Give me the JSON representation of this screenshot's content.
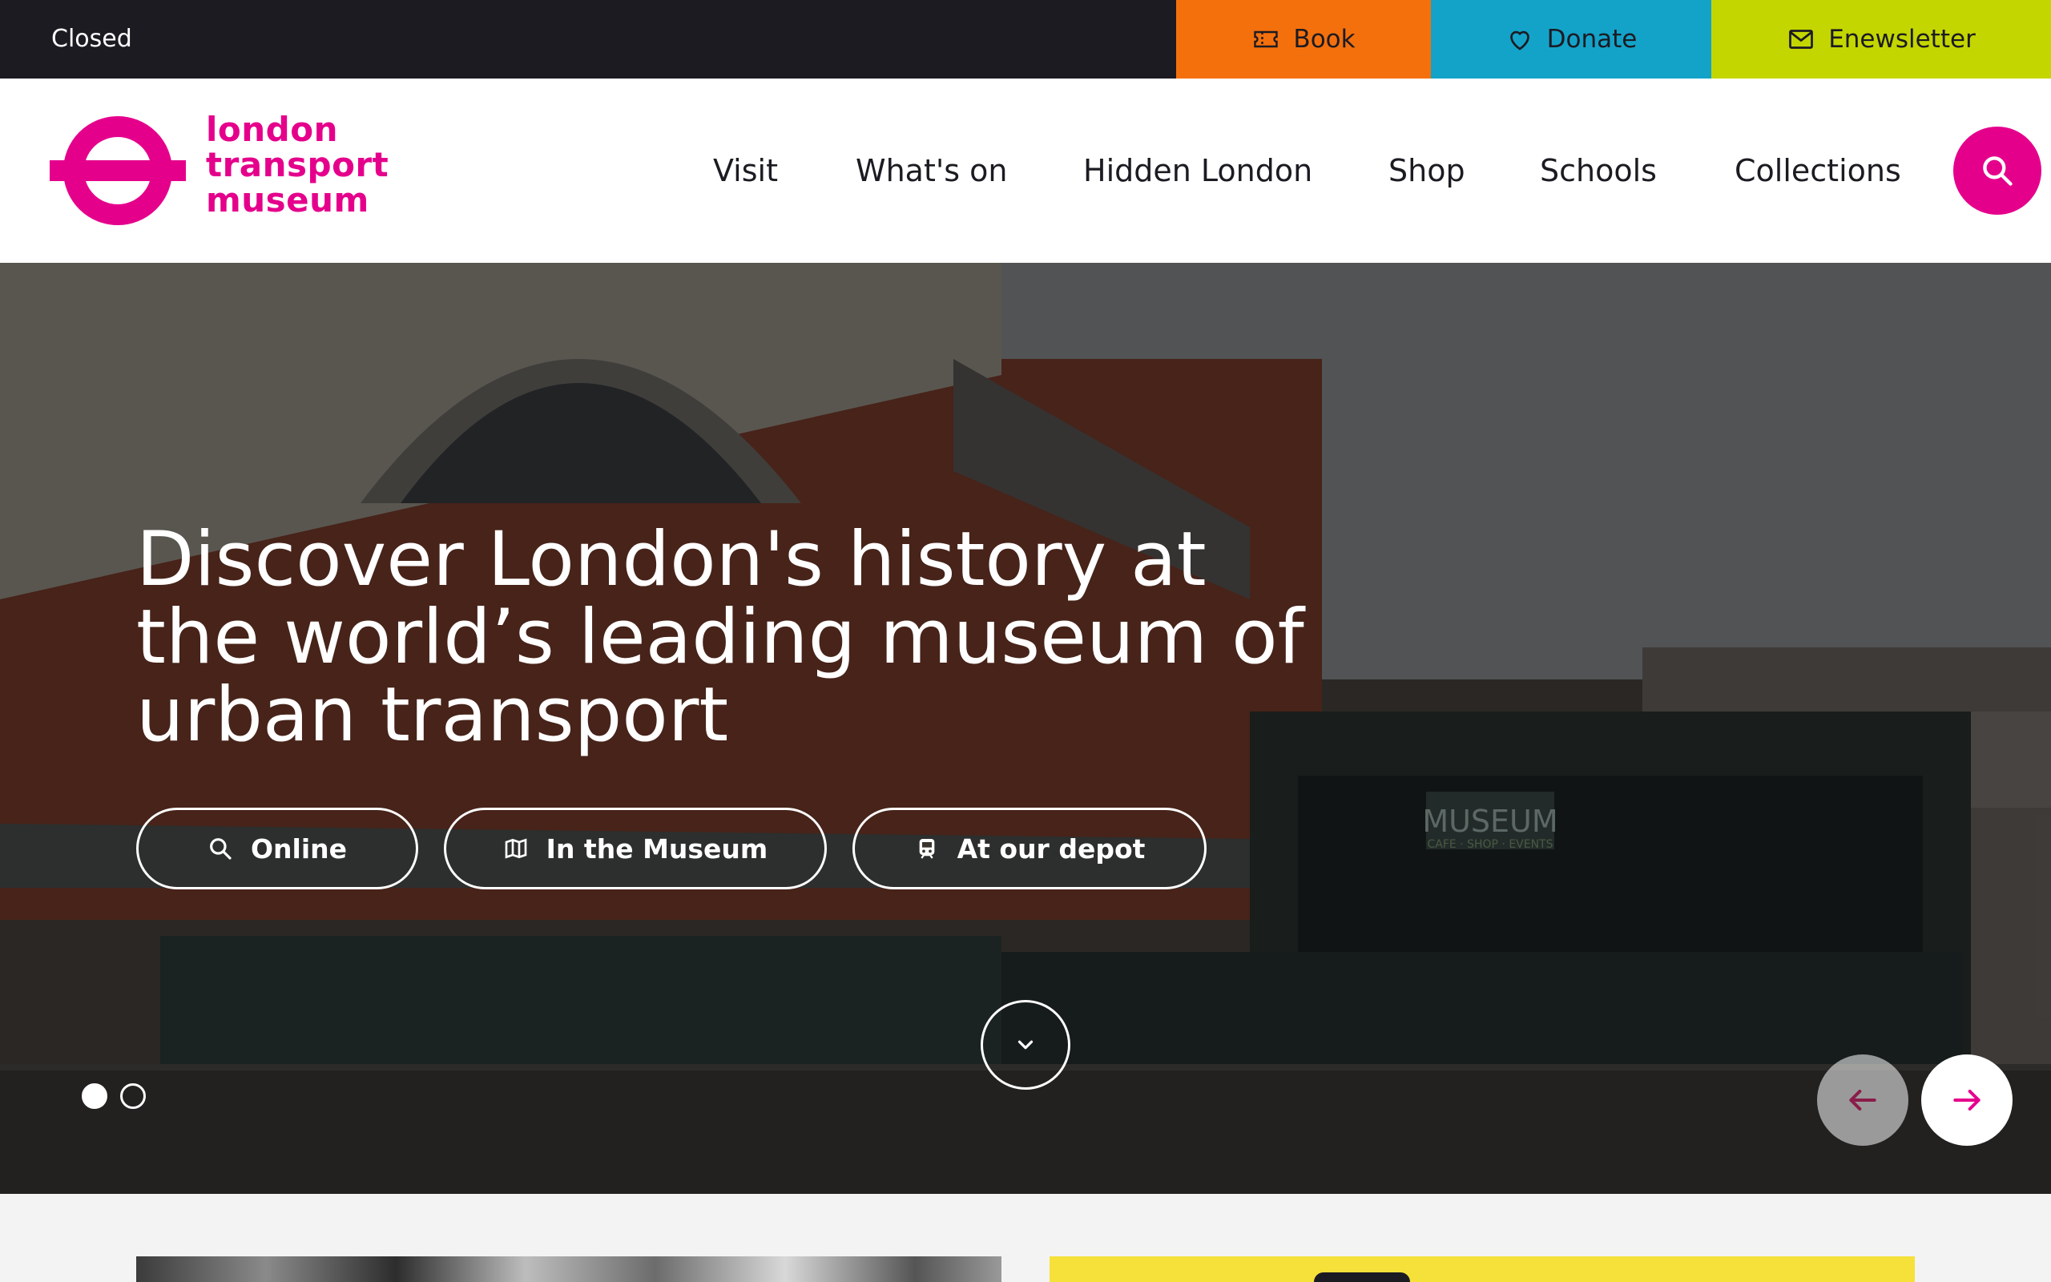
{
  "topbar": {
    "status": "Closed",
    "book_label": "Book",
    "donate_label": "Donate",
    "newsletter_label": "Enewsletter",
    "book_color": "#f4700d",
    "donate_color": "#13a3c9",
    "newsletter_color": "#c4d600"
  },
  "header": {
    "logo_line1": "london",
    "logo_line2": "transport",
    "logo_line3": "museum",
    "brand_color": "#e5008c",
    "nav": [
      "Visit",
      "What's on",
      "Hidden London",
      "Shop",
      "Schools",
      "Collections"
    ]
  },
  "hero": {
    "title_line1": "Discover London's history at",
    "title_line2": "the world’s leading museum of",
    "title_line3": "urban transport",
    "buttons": [
      {
        "label": "Online",
        "icon": "search-icon"
      },
      {
        "label": "In the Museum",
        "icon": "map-icon"
      },
      {
        "label": "At our depot",
        "icon": "train-icon"
      }
    ],
    "slide_count": 2,
    "active_slide": 1,
    "sign_text": "MUSEUM",
    "sign_subtext": "CAFE · SHOP · EVENTS"
  }
}
